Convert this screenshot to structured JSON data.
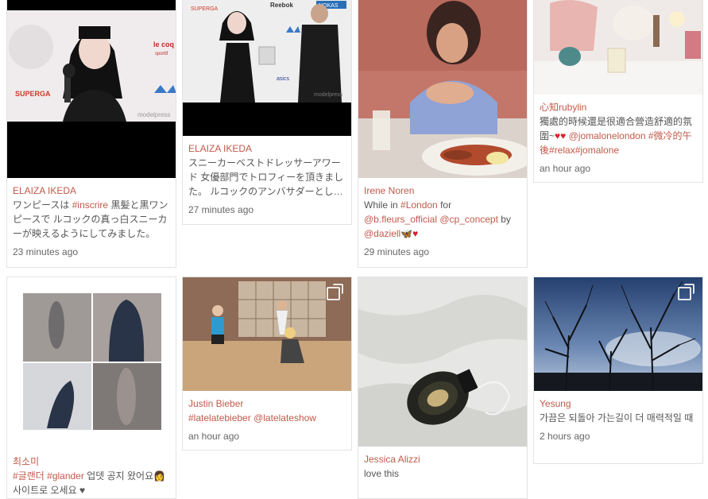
{
  "posts": [
    {
      "author": "ELAIZA IKEDA",
      "caption": [
        {
          "t": "ワンピースは "
        },
        {
          "t": "#inscrire",
          "hl": true
        },
        {
          "t": " 黒髪と黒ワンピースで ルコックの真っ白スニーカーが映えるようにしてみました。"
        }
      ],
      "time": "23 minutes ago"
    },
    {
      "author": "ELAIZA IKEDA",
      "caption": [
        {
          "t": "スニーカーベストドレッサーアワード 女優部門でトロフィーを頂きました。 ルコックのアンバサダーとし…"
        }
      ],
      "time": "27 minutes ago"
    },
    {
      "author": "Irene Noren",
      "caption": [
        {
          "t": "While in "
        },
        {
          "t": "#London",
          "hl": true
        },
        {
          "t": " for "
        },
        {
          "t": "@b.fleurs_official",
          "hl": true
        },
        {
          "t": " "
        },
        {
          "t": "@cp_concept",
          "hl": true
        },
        {
          "t": " by "
        },
        {
          "t": "@daziell",
          "hl": true
        },
        {
          "t": " 🦋",
          "emo": true
        },
        {
          "t": "♥",
          "emo": true,
          "heart": true
        }
      ],
      "time": "29 minutes ago"
    },
    {
      "author": "心知rubylin",
      "caption": [
        {
          "t": "獨處的時候還是很適合營造舒適的氛圍~"
        },
        {
          "t": "♥♥",
          "emo": true,
          "heart": true
        },
        {
          "t": " "
        },
        {
          "t": "@jomalonelondon",
          "hl": true
        },
        {
          "t": " "
        },
        {
          "t": "#微冷的午後",
          "hl": true
        },
        {
          "t": "#relax",
          "hl": true
        },
        {
          "t": "#jomalone",
          "hl": true
        }
      ],
      "time": "an hour ago"
    },
    {
      "author": "최소미",
      "caption": [
        {
          "t": "         "
        },
        {
          "t": "#글랜더",
          "hl": true
        },
        {
          "t": " "
        },
        {
          "t": "#glander",
          "hl": true
        },
        {
          "t": " 업뎃 공지 왔어요"
        },
        {
          "t": "👩",
          "emo": true
        },
        {
          "t": " 사이트로 오세요 "
        },
        {
          "t": "♥",
          "emo": true
        }
      ],
      "time": ""
    },
    {
      "author": "Justin Bieber",
      "caption": [
        {
          "t": "#latelatebieber",
          "hl": true
        },
        {
          "t": " "
        },
        {
          "t": "@latelateshow",
          "hl": true
        }
      ],
      "time": "an hour ago"
    },
    {
      "author": "Jessica Alizzi",
      "caption": [
        {
          "t": "love this"
        }
      ],
      "time": ""
    },
    {
      "author": "Yesung",
      "caption": [
        {
          "t": "가끔은 되돌아 가는길이 더 매력적일 때"
        }
      ],
      "time": "2 hours ago"
    }
  ],
  "images": {
    "p1": {
      "watermark": "modelpress",
      "sign1": "SUPERGA",
      "sign2": "le coq sportif"
    },
    "p2": {
      "watermark": "modelpress",
      "sign1": "Reebok",
      "sign2": "NOKAS",
      "sign3": "asics",
      "sign4": "SUPERGA"
    }
  },
  "colors": {
    "accent": "#c05a4b",
    "border": "#e3e3e3",
    "text": "#555555"
  }
}
